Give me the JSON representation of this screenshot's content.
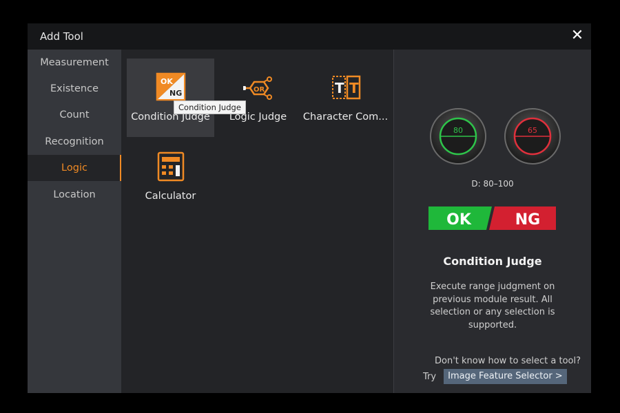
{
  "window": {
    "title": "Add Tool",
    "close_label": "✕"
  },
  "sidebar": {
    "items": [
      {
        "label": "Measurement"
      },
      {
        "label": "Existence"
      },
      {
        "label": "Count"
      },
      {
        "label": "Recognition"
      },
      {
        "label": "Logic",
        "active": true
      },
      {
        "label": "Location"
      }
    ]
  },
  "tools": [
    {
      "label": "Condition Judge",
      "icon": "ok-ng-icon",
      "hovered": true
    },
    {
      "label": "Logic Judge",
      "icon": "or-logic-icon"
    },
    {
      "label": "Character Com...",
      "icon": "tt-compare-icon"
    },
    {
      "label": "Calculator",
      "icon": "calculator-icon"
    }
  ],
  "tooltip": "Condition Judge",
  "preview": {
    "gauge_ok_value": "80",
    "gauge_ng_value": "65",
    "range_text": "D:  80–100",
    "ok_label": "OK",
    "ng_label": "NG",
    "colors": {
      "accent": "#f08a24",
      "ok": "#1fb83a",
      "ng": "#d32030"
    }
  },
  "detail": {
    "title": "Condition Judge",
    "description": "Execute range judgment on previous module result. All selection or any selection is supported."
  },
  "help": {
    "question": "Don't know how to select a tool?",
    "try_label": "Try",
    "link_label": "Image Feature Selector >"
  }
}
